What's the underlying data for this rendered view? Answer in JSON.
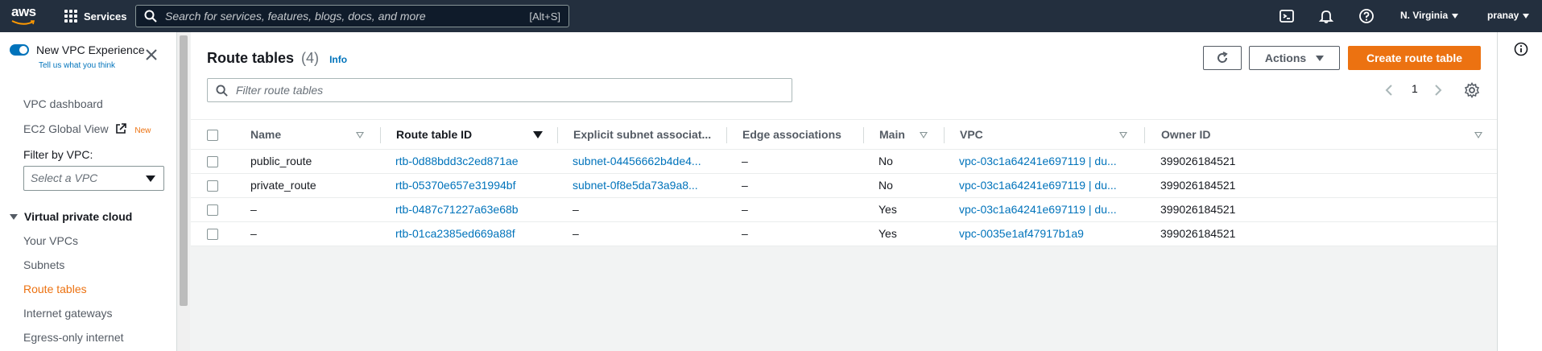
{
  "topnav": {
    "logo_text": "aws",
    "services_label": "Services",
    "search_placeholder": "Search for services, features, blogs, docs, and more",
    "search_shortcut": "[Alt+S]",
    "region": "N. Virginia",
    "user": "pranay",
    "icons": [
      "cloudshell-icon",
      "bell-icon",
      "help-icon"
    ]
  },
  "sidebar": {
    "toggle_label": "New VPC Experience",
    "toggle_on": true,
    "tell_us": "Tell us what you think",
    "links": {
      "vpc_dashboard": "VPC dashboard",
      "ec2_global_view": "EC2 Global View",
      "new_badge": "New"
    },
    "filter_label": "Filter by VPC:",
    "filter_placeholder": "Select a VPC",
    "section": "Virtual private cloud",
    "section_items": [
      "Your VPCs",
      "Subnets",
      "Route tables",
      "Internet gateways",
      "Egress-only internet"
    ],
    "active_item": "Route tables"
  },
  "main": {
    "title": "Route tables",
    "count": "(4)",
    "info": "Info",
    "actions_label": "Actions",
    "create_label": "Create route table",
    "filter_placeholder": "Filter route tables",
    "page_number": "1"
  },
  "table": {
    "columns": [
      "Name",
      "Route table ID",
      "Explicit subnet associat...",
      "Edge associations",
      "Main",
      "VPC",
      "Owner ID"
    ],
    "sorted_column": "Route table ID",
    "rows": [
      {
        "name": "public_route",
        "id": "rtb-0d88bdd3c2ed871ae",
        "subnet": "subnet-04456662b4de4...",
        "edge": "–",
        "main": "No",
        "vpc": "vpc-03c1a64241e697119 | du...",
        "owner": "399026184521"
      },
      {
        "name": "private_route",
        "id": "rtb-05370e657e31994bf",
        "subnet": "subnet-0f8e5da73a9a8...",
        "edge": "–",
        "main": "No",
        "vpc": "vpc-03c1a64241e697119 | du...",
        "owner": "399026184521"
      },
      {
        "name": "–",
        "id": "rtb-0487c71227a63e68b",
        "subnet": "–",
        "edge": "–",
        "main": "Yes",
        "vpc": "vpc-03c1a64241e697119 | du...",
        "owner": "399026184521"
      },
      {
        "name": "–",
        "id": "rtb-01ca2385ed669a88f",
        "subnet": "–",
        "edge": "–",
        "main": "Yes",
        "vpc": "vpc-0035e1af47917b1a9",
        "owner": "399026184521"
      }
    ]
  },
  "colors": {
    "nav_bg": "#232f3e",
    "accent_orange": "#ec7211",
    "link_blue": "#0073bb"
  }
}
